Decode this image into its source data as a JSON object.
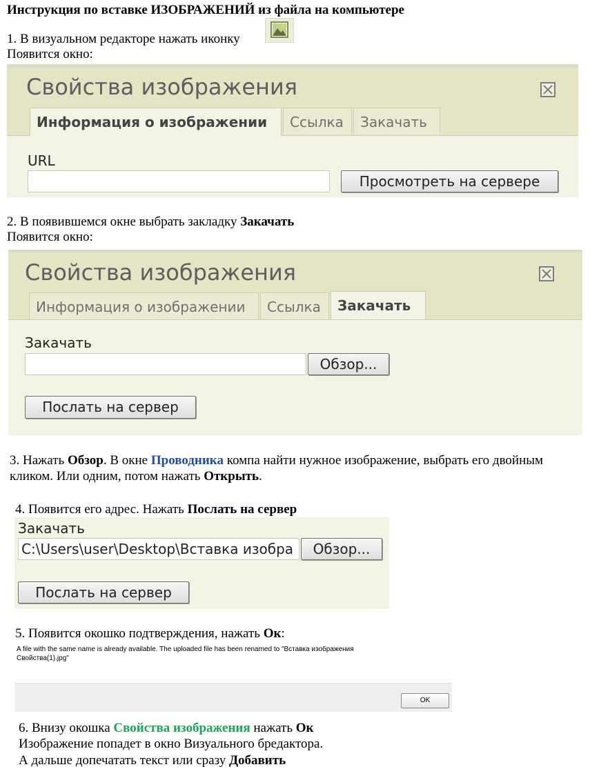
{
  "title": {
    "p1": "Инструкция по вставке ",
    "b1": "ИЗОБРАЖЕНИЙ",
    "p2": " из файла на компьютере"
  },
  "step1": {
    "text": "1. В визуальном редакторе нажать иконку",
    "after": "Появится окно:",
    "icon": "insert-image-icon"
  },
  "dialog1": {
    "title": "Свойства изображения",
    "tabs": [
      "Информация о изображении",
      "Ссылка",
      "Закачать"
    ],
    "active_tab": 0,
    "url_label": "URL",
    "url_value": "",
    "browse_server_button": "Просмотреть на сервере"
  },
  "step2": {
    "text": "2. В появившемся окне выбрать закладку ",
    "bold": "Закачать",
    "after": "Появится окно:"
  },
  "dialog2": {
    "title": "Свойства изображения",
    "tabs": [
      "Информация о изображении",
      "Ссылка",
      "Закачать"
    ],
    "active_tab": 2,
    "upload_label": "Закачать",
    "file_value": "",
    "browse_button": "Обзор...",
    "send_button": "Послать на сервер"
  },
  "step3": {
    "t1": "3. Нажать ",
    "b1": "Обзор",
    "t2": ". В окне ",
    "link": "Проводника",
    "t3": " компа найти нужное изображение, выбрать его двойным",
    "t4": "кликом. Или одним, потом нажать ",
    "b2": "Открыть",
    "t5": "."
  },
  "step4": {
    "t1": "4. Появится его адрес. Нажать ",
    "b1": "Послать на сервер"
  },
  "dialog3": {
    "upload_label": "Закачать",
    "file_value": "C:\\Users\\user\\Desktop\\Вставка изобра",
    "browse_button": "Обзор...",
    "send_button": "Послать на сервер"
  },
  "step5": {
    "t1": "5. Появится окошко подтверждения, нажать ",
    "b1": "Ок",
    "t2": ":"
  },
  "confirm": {
    "line1": "A file with the same name is already available. The uploaded file has been renamed to \"Вставка изображения",
    "line2": "Свойства(1).jpg\"",
    "ok_button": "OK"
  },
  "step6": {
    "t1": "6. Внизу окошка ",
    "g1": "Свойства изображения",
    "t2": " нажать ",
    "b1": "Ок",
    "line2": "Изображение попадет в окно Визуального бредактора.",
    "line3a": "А дальше допечатать текст или сразу ",
    "line3b": "Добавить"
  },
  "colors": {
    "link_blue": "#1f4e9c",
    "accent_green": "#1aa35a",
    "dialog_bg": "#f4f4e6",
    "dialog_header": "#e5e4c5"
  }
}
